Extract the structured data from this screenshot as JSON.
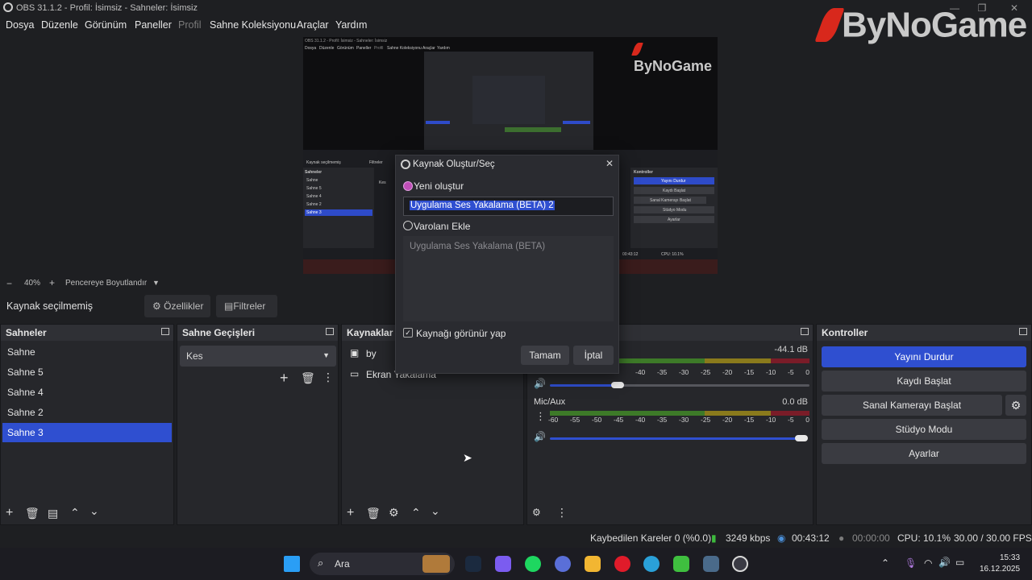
{
  "window": {
    "title": "OBS 31.1.2 - Profil: İsimsiz - Sahneler: İsimsiz"
  },
  "menu": [
    "Dosya",
    "Düzenle",
    "Görünüm",
    "Paneller",
    "Profil",
    "Sahne Koleksiyonu",
    "Araçlar",
    "Yardım"
  ],
  "watermark": "ByNoGame",
  "zoom": {
    "level": "40%",
    "fit_label": "Pencereye Boyutlandır"
  },
  "source_toolbar": {
    "status": "Kaynak seçilmemiş",
    "properties": "Özellikler",
    "filters": "Filtreler"
  },
  "scenes": {
    "title": "Sahneler",
    "items": [
      "Sahne",
      "Sahne 5",
      "Sahne 4",
      "Sahne 2",
      "Sahne 3"
    ],
    "selected_index": 4
  },
  "transitions": {
    "title": "Sahne Geçişleri",
    "selected": "Kes"
  },
  "sources": {
    "title": "Kaynaklar",
    "items": [
      "by",
      "Ekran Yakalama"
    ]
  },
  "mixer": {
    "channel1_db": "-44.1 dB",
    "channel2_name": "Mic/Aux",
    "channel2_db": "0.0 dB",
    "scale": [
      "-60",
      "-55",
      "-50",
      "-45",
      "-40",
      "-35",
      "-30",
      "-25",
      "-20",
      "-15",
      "-10",
      "-5",
      "0"
    ],
    "channel1_scale": [
      "-40",
      "-35",
      "-30",
      "-25",
      "-20",
      "-15",
      "-10",
      "-5",
      "0"
    ]
  },
  "controls": {
    "title": "Kontroller",
    "stop_stream": "Yayını Durdur",
    "start_record": "Kaydı Başlat",
    "virtual_cam": "Sanal Kamerayı Başlat",
    "studio_mode": "Stüdyo Modu",
    "settings": "Ayarlar"
  },
  "dialog": {
    "title": "Kaynak Oluştur/Seç",
    "create_new": "Yeni oluştur",
    "name_value": "Uygulama Ses Yakalama (BETA) 2",
    "add_existing": "Varolanı Ekle",
    "existing_item": "Uygulama Ses Yakalama (BETA)",
    "make_visible": "Kaynağı görünür yap",
    "ok": "Tamam",
    "cancel": "İptal"
  },
  "status": {
    "dropped": "Kaybedilen Kareler 0 (%0.0)",
    "bitrate": "3249 kbps",
    "stream_time": "00:43:12",
    "record_time": "00:00:00",
    "cpu": "CPU: 10.1%",
    "fps": "30.00 / 30.00 FPS"
  },
  "taskbar": {
    "search": "Ara",
    "time": "15:33",
    "date": "16.12.2025"
  },
  "mini_preview": {
    "menu": [
      "Dosya",
      "Düzenle",
      "Görünüm",
      "Paneller",
      "Profil",
      "Sahne Koleksiyonu",
      "Araçlar",
      "Yardım"
    ],
    "scenes_title": "Sahneler",
    "scenes": [
      "Sahne",
      "Sahne 5",
      "Sahne 4",
      "Sahne 2",
      "Sahne 3"
    ],
    "source_status": "Kaynak seçilmemiş",
    "filters": "Filtreler",
    "transition": "Kes",
    "controls_title": "Kontroller",
    "controls": [
      "Yayını Durdur",
      "Kaydı Başlat",
      "Sanal Kamerayı Başlat",
      "Stüdyo Modu",
      "Ayarlar"
    ],
    "status_time": "00:43:12",
    "status_cpu": "CPU: 10.1%"
  },
  "colors": {
    "accent": "#2f4fd0",
    "bg": "#1e1f22",
    "panel": "#26272b",
    "brand_red": "#d8281c"
  }
}
